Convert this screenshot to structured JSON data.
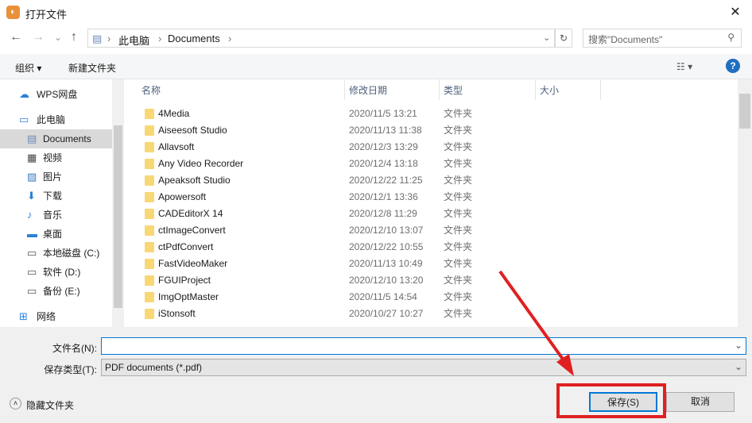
{
  "window": {
    "title": "打开文件",
    "close": "✕"
  },
  "nav": {
    "back": "←",
    "forward": "→",
    "recent": "⌄",
    "up": "↑",
    "path": [
      "此电脑",
      "Documents"
    ],
    "refresh": "↻",
    "search_placeholder": "搜索\"Documents\"",
    "search_icon": "⚲"
  },
  "toolbar": {
    "organize": "组织 ▾",
    "new_folder": "新建文件夹",
    "view": "☷ ▾",
    "help": "?"
  },
  "sidebar": {
    "items": [
      {
        "label": "WPS网盘",
        "icon": "cloud-icon"
      },
      {
        "label": "此电脑",
        "icon": "computer-icon"
      },
      {
        "label": "Documents",
        "icon": "document-icon",
        "selected": true
      },
      {
        "label": "视频",
        "icon": "video-icon"
      },
      {
        "label": "图片",
        "icon": "picture-icon"
      },
      {
        "label": "下载",
        "icon": "download-icon"
      },
      {
        "label": "音乐",
        "icon": "music-icon"
      },
      {
        "label": "桌面",
        "icon": "desktop-icon"
      },
      {
        "label": "本地磁盘 (C:)",
        "icon": "drive-icon"
      },
      {
        "label": "软件 (D:)",
        "icon": "drive-icon"
      },
      {
        "label": "备份 (E:)",
        "icon": "drive-icon"
      },
      {
        "label": "网络",
        "icon": "network-icon"
      }
    ]
  },
  "list": {
    "columns": [
      "名称",
      "修改日期",
      "类型",
      "大小"
    ],
    "rows": [
      {
        "name": "4Media",
        "date": "2020/11/5 13:21",
        "type": "文件夹"
      },
      {
        "name": "Aiseesoft Studio",
        "date": "2020/11/13 11:38",
        "type": "文件夹"
      },
      {
        "name": "Allavsoft",
        "date": "2020/12/3 13:29",
        "type": "文件夹"
      },
      {
        "name": "Any Video Recorder",
        "date": "2020/12/4 13:18",
        "type": "文件夹"
      },
      {
        "name": "Apeaksoft Studio",
        "date": "2020/12/22 11:25",
        "type": "文件夹"
      },
      {
        "name": "Apowersoft",
        "date": "2020/12/1 13:36",
        "type": "文件夹"
      },
      {
        "name": "CADEditorX 14",
        "date": "2020/12/8 11:29",
        "type": "文件夹"
      },
      {
        "name": "ctImageConvert",
        "date": "2020/12/10 13:07",
        "type": "文件夹"
      },
      {
        "name": "ctPdfConvert",
        "date": "2020/12/22 10:55",
        "type": "文件夹"
      },
      {
        "name": "FastVideoMaker",
        "date": "2020/11/13 10:49",
        "type": "文件夹"
      },
      {
        "name": "FGUIProject",
        "date": "2020/12/10 13:20",
        "type": "文件夹"
      },
      {
        "name": "ImgOptMaster",
        "date": "2020/11/5 14:54",
        "type": "文件夹"
      },
      {
        "name": "iStonsoft",
        "date": "2020/10/27 10:27",
        "type": "文件夹"
      }
    ]
  },
  "form": {
    "filename_label": "文件名(N):",
    "filename_value": "",
    "filetype_label": "保存类型(T):",
    "filetype_value": "PDF documents (*.pdf)"
  },
  "footer": {
    "hide_folders": "隐藏文件夹",
    "save": "保存(S)",
    "cancel": "取消"
  },
  "colors": {
    "annotation": "#e02020",
    "accent": "#0078d7"
  }
}
